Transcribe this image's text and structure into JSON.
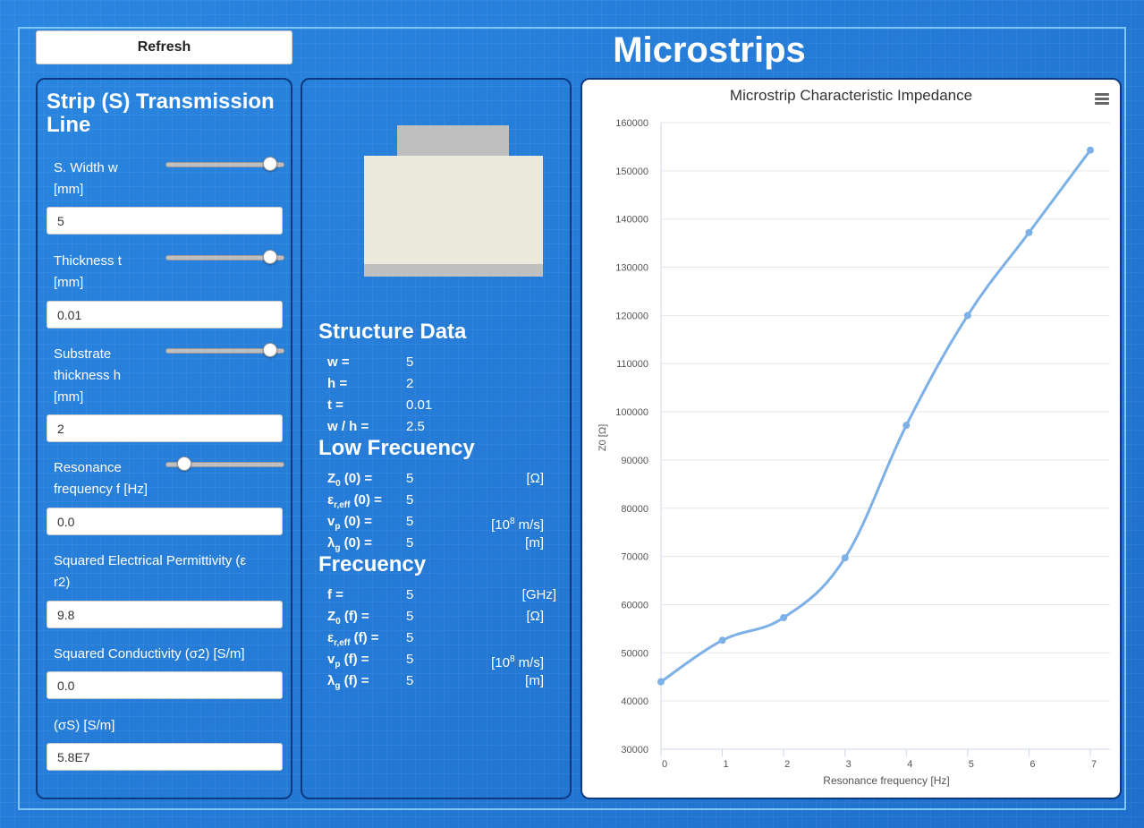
{
  "header": {
    "refresh_label": "Refresh",
    "title": "Microstrips"
  },
  "left_panel": {
    "title": "Strip (S) Transmission Line",
    "width": {
      "label_line1": "S. Width w",
      "label_line2": "[mm]",
      "value": "5",
      "slider_fraction": 0.92
    },
    "thickness": {
      "label_line1": "Thickness t",
      "label_line2": "[mm]",
      "value": "0.01",
      "slider_fraction": 0.92
    },
    "substrate": {
      "label_line1": "Substrate",
      "label_line2": "thickness h",
      "label_line3": "[mm]",
      "value": "2",
      "slider_fraction": 0.92
    },
    "resonance": {
      "label_line1": "Resonance",
      "label_line2": "frequency f [Hz]",
      "value": "0.0",
      "slider_fraction": 0.1
    },
    "permittivity": {
      "label_line1": "Squared Electrical Permittivity (ε",
      "label_line2": "r2)",
      "value": "9.8"
    },
    "conductivity2": {
      "label": "Squared Conductivity (σ2) [S/m]",
      "value": "0.0"
    },
    "conductivityS": {
      "label": "(σS) [S/m]",
      "value": "5.8E7"
    }
  },
  "structure_data": {
    "title": "Structure Data",
    "rows": [
      {
        "sym": "w =",
        "val": "5"
      },
      {
        "sym": "h =",
        "val": "2"
      },
      {
        "sym": "t =",
        "val": "0.01"
      },
      {
        "sym": "w / h =",
        "val": "2.5"
      }
    ]
  },
  "low_frequency": {
    "title": "Low Frecuency",
    "z0": {
      "sym": "Z",
      "sub": "0",
      "tail": " (0) =",
      "val": "5",
      "unit": "[Ω]"
    },
    "eps": {
      "sym": "ε",
      "sub": "r,eff",
      "tail": " (0) =",
      "val": "5"
    },
    "vp": {
      "sym": "v",
      "sub": "p",
      "tail": " (0) =",
      "val": "5",
      "unit_pre": "[10",
      "unit_sup": "8",
      "unit_post": " m/s]"
    },
    "lambda": {
      "sym": "λ",
      "sub": "g",
      "tail": " (0) =",
      "val": "5",
      "unit": "[m]"
    }
  },
  "frequency": {
    "title": "Frecuency",
    "f": {
      "sym": "f =",
      "val": "5",
      "unit": "[GHz]"
    },
    "z0": {
      "sym": "Z",
      "sub": "0",
      "tail": " (f) =",
      "val": "5",
      "unit": "[Ω]"
    },
    "eps": {
      "sym": "ε",
      "sub": "r,eff",
      "tail": " (f) =",
      "val": "5"
    },
    "vp": {
      "sym": "v",
      "sub": "p",
      "tail": " (f) =",
      "val": "5",
      "unit_pre": "[10",
      "unit_sup": "8",
      "unit_post": " m/s]"
    },
    "lambda": {
      "sym": "λ",
      "sub": "g",
      "tail": " (f) =",
      "val": "5",
      "unit": "[m]"
    }
  },
  "chart_data": {
    "type": "line",
    "title": "Microstrip Characteristic Impedance",
    "xlabel": "Resonance frequency [Hz]",
    "ylabel": "Z0 [Ω]",
    "x": [
      0,
      1,
      2,
      3,
      4,
      5,
      6,
      7
    ],
    "y": [
      44000,
      52600,
      57300,
      69700,
      97200,
      120000,
      137200,
      154300
    ],
    "xlim": [
      0,
      7
    ],
    "ylim": [
      30000,
      160000
    ],
    "yticks": [
      30000,
      40000,
      50000,
      60000,
      70000,
      80000,
      90000,
      100000,
      110000,
      120000,
      130000,
      140000,
      150000,
      160000
    ],
    "xticks": [
      0,
      1,
      2,
      3,
      4,
      5,
      6,
      7
    ],
    "grid": true,
    "line_color": "#7cb0e6",
    "menu_icon": "hamburger-menu-icon"
  }
}
